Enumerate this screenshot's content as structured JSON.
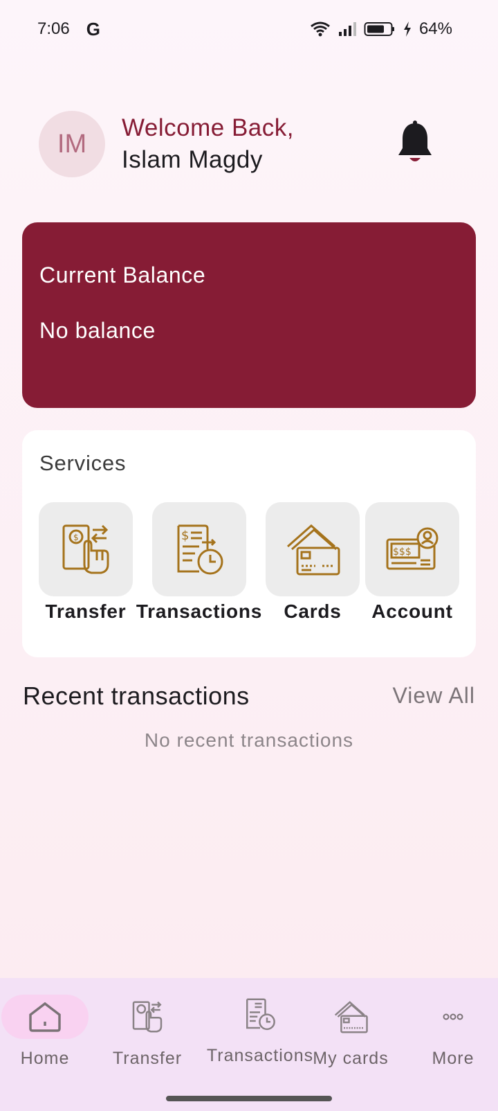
{
  "status_bar": {
    "time": "7:06",
    "google_icon": "G",
    "battery": "64%"
  },
  "header": {
    "avatar_initials": "IM",
    "welcome": "Welcome Back,",
    "name": "Islam Magdy"
  },
  "balance": {
    "label": "Current Balance",
    "value": "No balance"
  },
  "services": {
    "title": "Services",
    "items": [
      {
        "label": "Transfer",
        "icon": "transfer-icon"
      },
      {
        "label": "Transactions",
        "icon": "transactions-icon"
      },
      {
        "label": "Cards",
        "icon": "cards-icon"
      },
      {
        "label": "Account",
        "icon": "account-icon"
      }
    ]
  },
  "recent": {
    "title": "Recent transactions",
    "view_all": "View All",
    "empty_message": "No recent transactions"
  },
  "bottom_nav": {
    "items": [
      {
        "label": "Home",
        "icon": "home-icon",
        "active": true
      },
      {
        "label": "Transfer",
        "icon": "transfer-icon"
      },
      {
        "label": "Transactions",
        "icon": "transactions-icon"
      },
      {
        "label": "My cards",
        "icon": "cards-icon"
      },
      {
        "label": "More",
        "icon": "more-icon"
      }
    ]
  },
  "colors": {
    "brand": "#861c35",
    "gold_icon": "#a5731c",
    "nav_background": "#f3e1f6",
    "nav_active_pill": "#f9d2f1"
  }
}
